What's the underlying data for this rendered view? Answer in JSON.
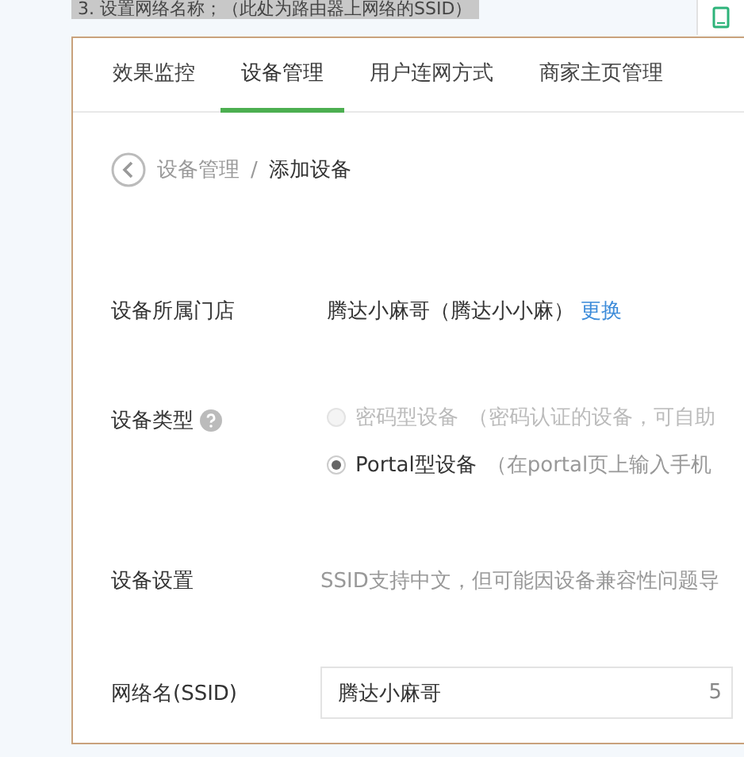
{
  "caption": "3. 设置网络名称；（此处为路由器上网络的SSID）",
  "tabs": [
    {
      "label": "效果监控",
      "selected": false
    },
    {
      "label": "设备管理",
      "selected": true
    },
    {
      "label": "用户连网方式",
      "selected": false
    },
    {
      "label": "商家主页管理",
      "selected": false
    }
  ],
  "breadcrumb": {
    "parent": "设备管理",
    "separator": "/",
    "current": "添加设备"
  },
  "store": {
    "label": "设备所属门店",
    "value": "腾达小麻哥（腾达小小麻）",
    "link": "更换"
  },
  "device_type": {
    "label": "设备类型",
    "options": [
      {
        "name": "密码型设备",
        "desc": "（密码认证的设备，可自助",
        "selected": false,
        "disabled": true
      },
      {
        "name": "Portal型设备",
        "desc": "（在portal页上输入手机",
        "selected": true,
        "disabled": false
      }
    ]
  },
  "settings": {
    "label": "设备设置",
    "hint": "SSID支持中文，但可能因设备兼容性问题导"
  },
  "ssid": {
    "label": "网络名(SSID)",
    "value": "腾达小麻哥",
    "count": "5"
  }
}
